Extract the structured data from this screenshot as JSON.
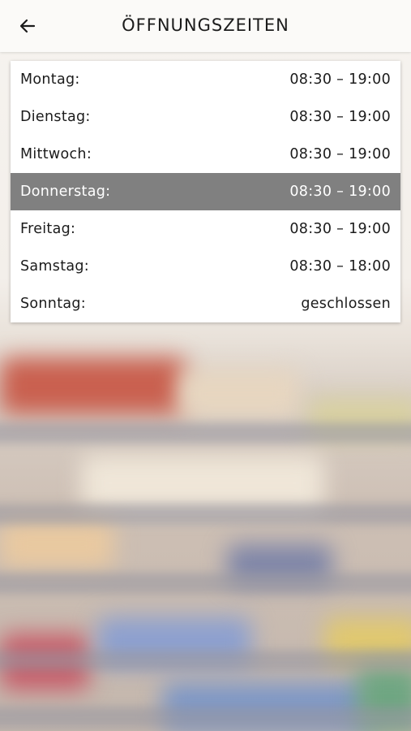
{
  "header": {
    "back_icon": "arrow-left-icon",
    "title": "ÖFFNUNGSZEITEN"
  },
  "hours": [
    {
      "day": "Montag:",
      "time": "08:30 – 19:00",
      "highlighted": false
    },
    {
      "day": "Dienstag:",
      "time": "08:30 – 19:00",
      "highlighted": false
    },
    {
      "day": "Mittwoch:",
      "time": "08:30 – 19:00",
      "highlighted": false
    },
    {
      "day": "Donnerstag:",
      "time": "08:30 – 19:00",
      "highlighted": true
    },
    {
      "day": "Freitag:",
      "time": "08:30 – 19:00",
      "highlighted": false
    },
    {
      "day": "Samstag:",
      "time": "08:30 – 18:00",
      "highlighted": false
    },
    {
      "day": "Sonntag:",
      "time": "geschlossen",
      "highlighted": false
    }
  ],
  "colors": {
    "highlight": "#808080",
    "card": "#ffffff",
    "header": "#fbfaf8"
  }
}
